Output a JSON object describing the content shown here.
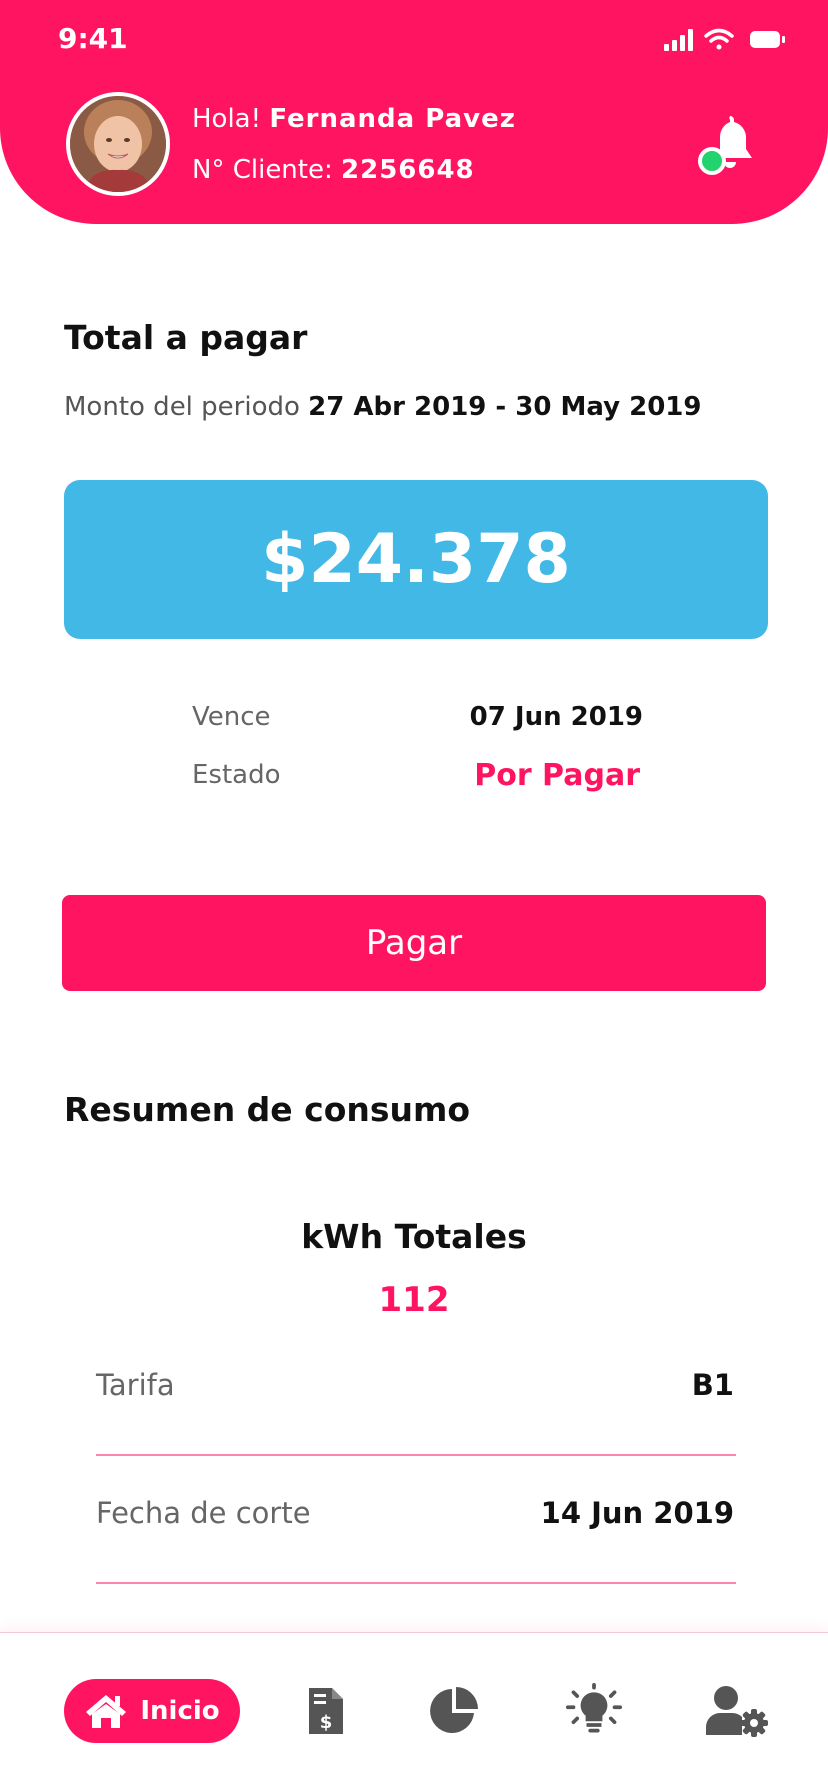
{
  "status_bar": {
    "time": "9:41"
  },
  "header": {
    "greeting_prefix": "Hola!",
    "user_name": "Fernanda Pavez",
    "client_label": "N° Cliente:",
    "client_number": "2256648"
  },
  "summary": {
    "title": "Total a pagar",
    "period_label": "Monto del periodo",
    "period_value": "27 Abr 2019 - 30 May 2019",
    "amount": "$24.378",
    "due_label": "Vence",
    "due_value": "07 Jun 2019",
    "status_label": "Estado",
    "status_value": "Por Pagar",
    "pay_button": "Pagar"
  },
  "consumption": {
    "title": "Resumen de consumo",
    "kwh_label": "kWh Totales",
    "kwh_value": "112",
    "rows": [
      {
        "label": "Tarifa",
        "value": "B1"
      },
      {
        "label": "Fecha de corte",
        "value": "14 Jun 2019"
      }
    ]
  },
  "tabbar": {
    "home_label": "Inicio",
    "tabs": [
      "home-icon",
      "invoice-icon",
      "pie-chart-icon",
      "lightbulb-icon",
      "user-settings-icon"
    ]
  },
  "colors": {
    "brand": "#ff1461",
    "accent": "#42b8e6",
    "online": "#22d36e"
  }
}
